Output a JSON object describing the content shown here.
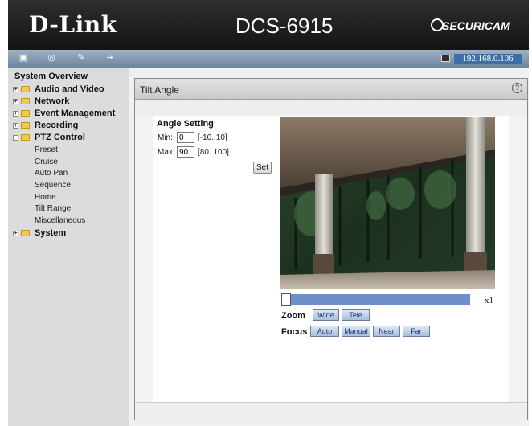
{
  "header": {
    "brand": "D-Link",
    "model": "DCS-6915",
    "product_line": "SECURICAM",
    "ip_address": "192.168.0.106"
  },
  "toolbar": {
    "icons": [
      "camera-icon",
      "search-icon",
      "settings-icon",
      "logout-icon"
    ]
  },
  "sidebar": {
    "title": "System Overview",
    "items": [
      {
        "label": "Audio and Video",
        "expanded": false
      },
      {
        "label": "Network",
        "expanded": false
      },
      {
        "label": "Event Management",
        "expanded": false
      },
      {
        "label": "Recording",
        "expanded": false
      },
      {
        "label": "PTZ Control",
        "expanded": true
      },
      {
        "label": "System",
        "expanded": false
      }
    ],
    "ptz_subitems": [
      "Preset",
      "Cruise",
      "Auto Pan",
      "Sequence",
      "Home",
      "Tilt Range",
      "Miscellaneous"
    ]
  },
  "panel": {
    "title": "Tilt Angle",
    "help": "?",
    "angle_setting": {
      "heading": "Angle Setting",
      "min_label": "Min:",
      "min_value": "0",
      "min_range": "[-10..10]",
      "max_label": "Max:",
      "max_value": "90",
      "max_range": "[80..100]",
      "set_label": "Set"
    },
    "zoom_level": "x1",
    "zoom": {
      "label": "Zoom",
      "buttons": [
        "Wide",
        "Tele"
      ]
    },
    "focus": {
      "label": "Focus",
      "buttons": [
        "Auto",
        "Manual",
        "Near",
        "Far"
      ]
    }
  },
  "colors": {
    "header_bg": "#1f1f1f",
    "toolbar_bg": "#8198b0",
    "sidebar_bg": "#dcdcdc",
    "zoom_bar": "#6b8fc8",
    "button_bg": "#b9cbe6"
  }
}
